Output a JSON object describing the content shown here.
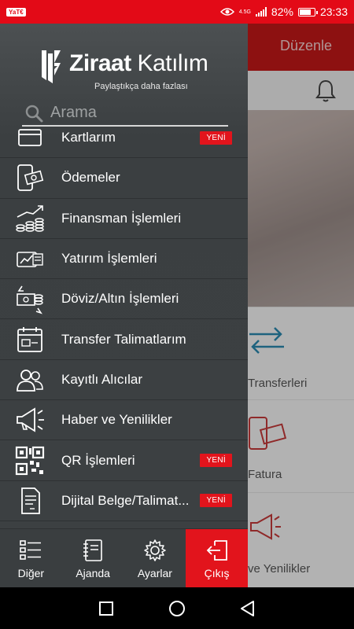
{
  "status_bar": {
    "app_badge": "YaT€",
    "network": "4.5G",
    "battery_percent": "82%",
    "time": "23:33"
  },
  "background_app": {
    "edit_label": "Düzenle",
    "tiles": [
      {
        "label": "Transferleri",
        "icon": "transfer-arrows-icon"
      },
      {
        "label": "Fatura",
        "icon": "bill-payment-icon"
      },
      {
        "label": "ve Yenilikler",
        "icon": "megaphone-icon"
      }
    ]
  },
  "drawer": {
    "brand_bold": "Ziraat",
    "brand_light": " Katılım",
    "tagline": "Paylaştıkça daha fazlası",
    "search_placeholder": "Arama",
    "items": [
      {
        "label": "Kartlarım",
        "icon": "cards-icon",
        "badge": "YENİ"
      },
      {
        "label": "Ödemeler",
        "icon": "payments-icon",
        "badge": ""
      },
      {
        "label": "Finansman İşlemleri",
        "icon": "finance-growth-icon",
        "badge": ""
      },
      {
        "label": "Yatırım İşlemleri",
        "icon": "investment-icon",
        "badge": ""
      },
      {
        "label": "Döviz/Altın İşlemleri",
        "icon": "currency-exchange-icon",
        "badge": ""
      },
      {
        "label": "Transfer Talimatlarım",
        "icon": "calendar-instruction-icon",
        "badge": ""
      },
      {
        "label": "Kayıtlı Alıcılar",
        "icon": "people-icon",
        "badge": ""
      },
      {
        "label": "Haber ve Yenilikler",
        "icon": "megaphone-icon",
        "badge": ""
      },
      {
        "label": "QR İşlemleri",
        "icon": "qr-code-icon",
        "badge": "YENİ"
      },
      {
        "label": "Dijital Belge/Talimat...",
        "icon": "document-icon",
        "badge": "YENİ"
      }
    ],
    "bottom_nav": [
      {
        "label": "Diğer",
        "icon": "list-icon",
        "active": false
      },
      {
        "label": "Ajanda",
        "icon": "notebook-icon",
        "active": false
      },
      {
        "label": "Ayarlar",
        "icon": "gear-icon",
        "active": false
      },
      {
        "label": "Çıkış",
        "icon": "logout-icon",
        "active": true
      }
    ]
  },
  "colors": {
    "brand_red": "#e2141c",
    "drawer_bg": "#3c4042",
    "status_bar": "#e30a17"
  }
}
